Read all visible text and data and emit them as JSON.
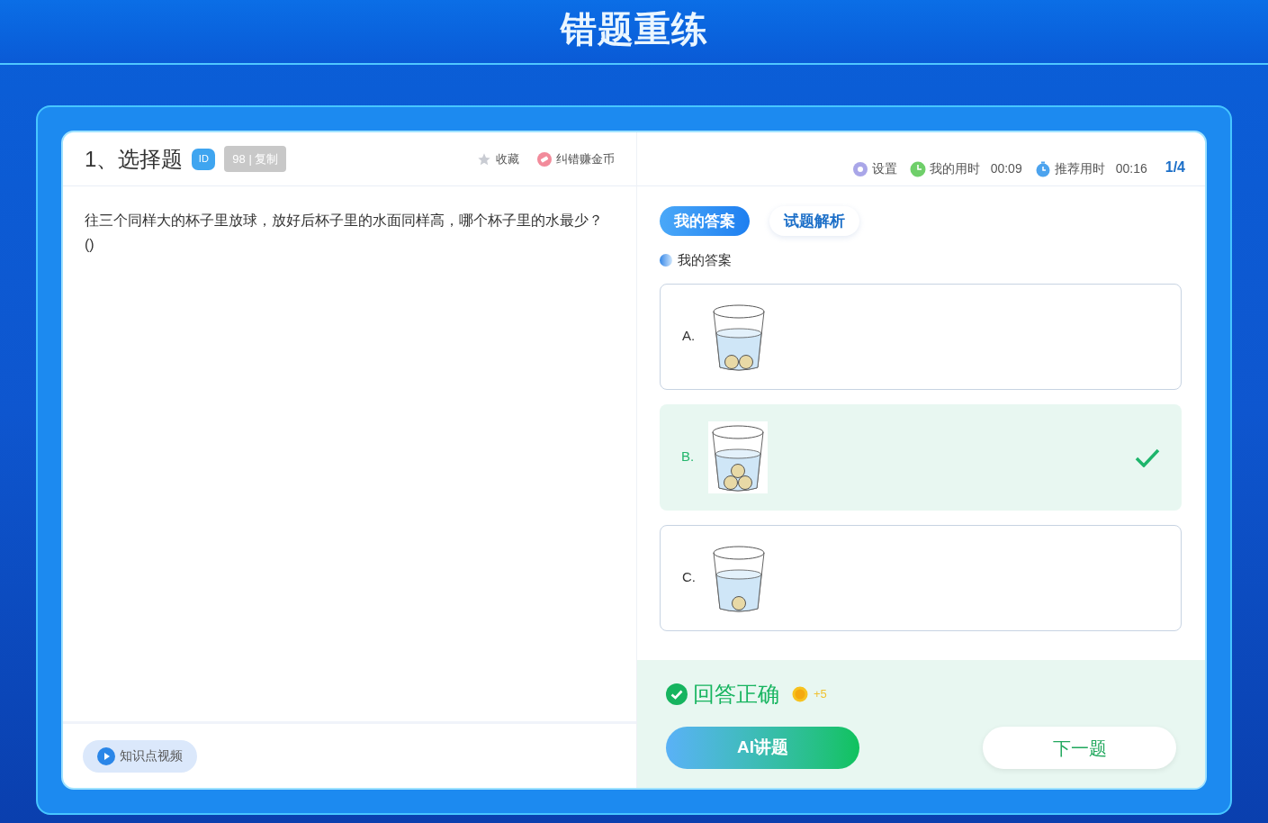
{
  "page_title": "错题重练",
  "question": {
    "heading": "1、选择题",
    "id_badge": "ID",
    "id_tip": "98 | 复制",
    "actions": [
      {
        "kind": "favorite",
        "label": "收藏"
      },
      {
        "kind": "coins",
        "label": "纠错赚金币"
      }
    ],
    "text": "往三个同样大的杯子里放球，放好后杯子里的水面同样高，哪个杯子里的水最少？ ()",
    "video_button": "知识点视频"
  },
  "toolbar": {
    "settings": "设置",
    "my_time_label": "我的用时",
    "my_time": "00:09",
    "suggested_time_label": "推荐用时",
    "suggested_time": "00:16",
    "progress": "1/4"
  },
  "tabs": [
    {
      "label": "我的答案",
      "selected": true
    },
    {
      "label": "试题解析",
      "selected": false
    }
  ],
  "answer_section": "我的答案",
  "options": [
    {
      "letter": "A.",
      "kind": "two-balls",
      "selected": false
    },
    {
      "letter": "B.",
      "kind": "three-balls",
      "selected": true
    },
    {
      "letter": "C.",
      "kind": "one-ball",
      "selected": false
    }
  ],
  "result": {
    "kind": "correct",
    "text": "回答正确",
    "reward": "+5"
  },
  "buttons": {
    "ai": "AI讲题",
    "next": "下一题"
  }
}
